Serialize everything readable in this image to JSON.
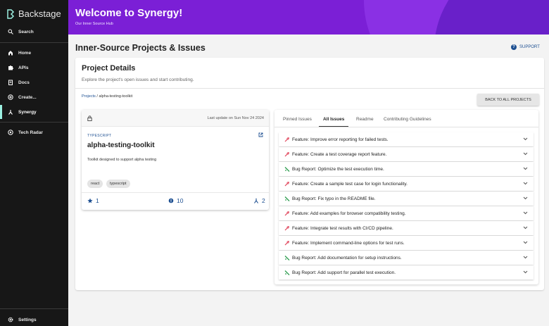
{
  "sidebar": {
    "logo": "Backstage",
    "search": "Search",
    "items": [
      "Home",
      "APIs",
      "Docs",
      "Create...",
      "Synergy"
    ],
    "tech_radar": "Tech Radar",
    "settings": "Settings"
  },
  "header": {
    "title": "Welcome to Synergy!",
    "subtitle": "Our Inner Source Hub"
  },
  "page": {
    "title": "Inner-Source Projects & Issues",
    "support": "SUPPORT"
  },
  "details": {
    "title": "Project Details",
    "description": "Explore the project's open issues and start contributing.",
    "breadcrumb_link": "Projects",
    "breadcrumb_current": " / alpha-testing-toolkit",
    "back_button": "BACK TO ALL PROJECTS"
  },
  "project": {
    "last_update": "Last update on Sun Nov 24 2024",
    "language": "TYPESCRIPT",
    "name": "alpha-testing-toolkit",
    "description": "Toolkit designed to support alpha testing",
    "tags": [
      "react",
      "typescript"
    ],
    "stars": "1",
    "issues": "10",
    "forks": "2"
  },
  "tabs": [
    "Pinned Issues",
    "All Issues",
    "Readme",
    "Contributing Guidelines"
  ],
  "active_tab": "All Issues",
  "issues": [
    {
      "type": "feature",
      "title": "Feature: Improve error reporting for failed tests."
    },
    {
      "type": "feature",
      "title": "Feature: Create a test coverage report feature."
    },
    {
      "type": "bug",
      "title": "Bug Report: Optimize the test execution time."
    },
    {
      "type": "feature",
      "title": "Feature: Create a sample test case for login functionality."
    },
    {
      "type": "bug",
      "title": "Bug Report: Fix typo in the README file."
    },
    {
      "type": "feature",
      "title": "Feature: Add examples for browser compatibility testing."
    },
    {
      "type": "feature",
      "title": "Feature: Integrate test results with CI/CD pipeline."
    },
    {
      "type": "feature",
      "title": "Feature: Implement command-line options for test runs."
    },
    {
      "type": "bug",
      "title": "Bug Report: Add documentation for setup instructions."
    },
    {
      "type": "bug",
      "title": "Bug Report: Add support for parallel test execution."
    }
  ],
  "colors": {
    "accent": "#7b1fd6",
    "link": "#1d4f91",
    "feature": "#e0445a",
    "bug": "#2e9e4f"
  }
}
